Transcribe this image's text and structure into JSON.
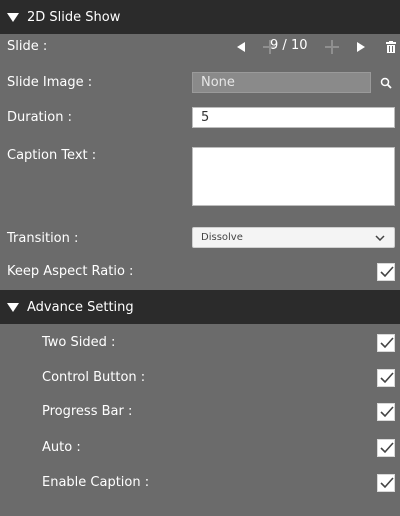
{
  "panel": {
    "title": "2D Slide Show"
  },
  "slide": {
    "label": "Slide :",
    "current": "9",
    "total": "10",
    "separator": "/"
  },
  "slide_image": {
    "label": "Slide Image :",
    "value": "None"
  },
  "duration": {
    "label": "Duration :",
    "value": "5"
  },
  "caption": {
    "label": "Caption Text :",
    "value": ""
  },
  "transition": {
    "label": "Transition :",
    "value": "Dissolve"
  },
  "keep_aspect": {
    "label": "Keep Aspect Ratio :",
    "checked": true
  },
  "advanced": {
    "title": "Advance Setting",
    "items": [
      {
        "label": "Two Sided :",
        "checked": true
      },
      {
        "label": "Control Button :",
        "checked": true
      },
      {
        "label": "Progress Bar :",
        "checked": true
      },
      {
        "label": "Auto :",
        "checked": true
      },
      {
        "label": "Enable Caption :",
        "checked": true
      }
    ]
  },
  "colors": {
    "panel_bg": "#6b6b6b",
    "header_bg": "#2b2b2b"
  },
  "icons": [
    "triangle-down-icon",
    "arrow-left-icon",
    "arrow-right-icon",
    "plus-icon",
    "trash-icon",
    "search-icon",
    "chevron-down-icon",
    "checkmark-icon"
  ]
}
